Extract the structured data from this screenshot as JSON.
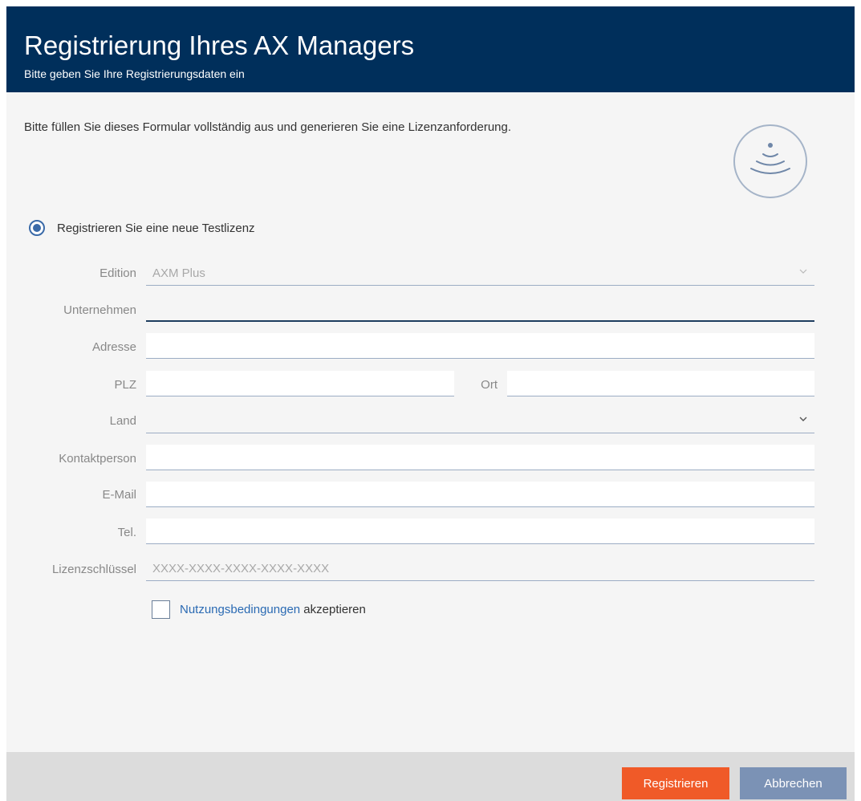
{
  "header": {
    "title": "Registrierung Ihres AX Managers",
    "subtitle": "Bitte geben Sie Ihre Registrierungsdaten ein"
  },
  "intro": "Bitte füllen Sie dieses Formular vollständig aus und generieren Sie eine Lizenzanforderung.",
  "radio": {
    "label": "Registrieren Sie eine neue Testlizenz",
    "checked": true
  },
  "form": {
    "edition_label": "Edition",
    "edition_value": "AXM Plus",
    "company_label": "Unternehmen",
    "company_value": "",
    "address_label": "Adresse",
    "address_value": "",
    "zip_label": "PLZ",
    "zip_value": "",
    "city_label": "Ort",
    "city_value": "",
    "country_label": "Land",
    "country_value": "",
    "contact_label": "Kontaktperson",
    "contact_value": "",
    "email_label": "E-Mail",
    "email_value": "",
    "phone_label": "Tel.",
    "phone_value": "",
    "license_label": "Lizenzschlüssel",
    "license_placeholder": "XXXX-XXXX-XXXX-XXXX-XXXX"
  },
  "terms": {
    "link": "Nutzungsbedingungen",
    "suffix": " akzeptieren",
    "checked": false
  },
  "footer": {
    "register": "Registrieren",
    "cancel": "Abbrechen"
  },
  "colors": {
    "header_bg": "#002f5b",
    "primary": "#f05a28",
    "secondary": "#7b92b5",
    "link": "#2a6ab3"
  },
  "icons": {
    "logo": "wireless-signal-icon",
    "dropdown": "chevron-down-icon"
  }
}
